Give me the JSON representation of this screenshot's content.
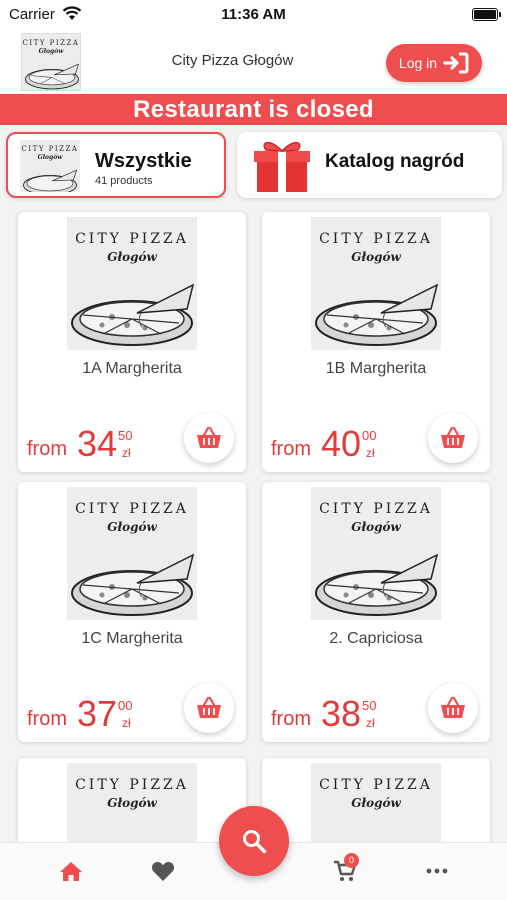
{
  "status_bar": {
    "carrier": "Carrier",
    "time": "11:36 AM"
  },
  "header": {
    "title": "City Pizza Głogów",
    "login_label": "Log in"
  },
  "banner": "Restaurant is closed",
  "art": {
    "line1": "CITY PIZZA",
    "line2": "Głogów"
  },
  "categories": [
    {
      "name": "Wszystkie",
      "count": "41 products"
    },
    {
      "name": "Katalog nagród"
    }
  ],
  "products": [
    {
      "name": "1A Margherita",
      "from": "from",
      "price": "34",
      "cents": "50",
      "currency": "zł"
    },
    {
      "name": "1B Margherita",
      "from": "from",
      "price": "40",
      "cents": "00",
      "currency": "zł"
    },
    {
      "name": "1C Margherita",
      "from": "from",
      "price": "37",
      "cents": "00",
      "currency": "zł"
    },
    {
      "name": "2. Capriciosa",
      "from": "from",
      "price": "38",
      "cents": "50",
      "currency": "zł"
    }
  ],
  "bottom_nav": {
    "cart_count": "0"
  },
  "colors": {
    "accent": "#ef4e4e"
  }
}
